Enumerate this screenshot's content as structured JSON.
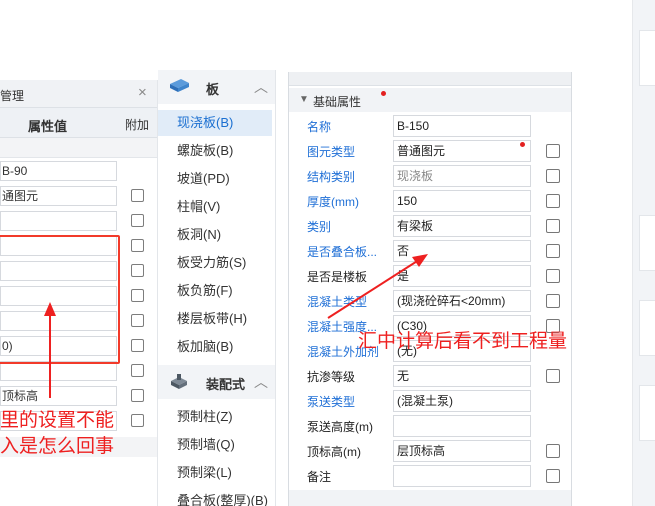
{
  "left_panel": {
    "title": "管理",
    "close_icon": "close-icon",
    "col_value": "属性值",
    "col_attach": "附加",
    "values": [
      "B-90",
      "通图元",
      "",
      "",
      "",
      "",
      "",
      "0)",
      "",
      "顶标高",
      ""
    ]
  },
  "nav": {
    "cat_slab": {
      "label": "板",
      "icon": "slab-icon"
    },
    "slab_items": [
      "现浇板(B)",
      "螺旋板(B)",
      "坡道(PD)",
      "柱帽(V)",
      "板洞(N)",
      "板受力筋(S)",
      "板负筋(F)",
      "楼层板带(H)",
      "板加脑(B)"
    ],
    "active_index": 0,
    "cat_prefab": {
      "label": "装配式",
      "icon": "prefab-icon"
    },
    "prefab_items": [
      "预制柱(Z)",
      "预制墙(Q)",
      "预制梁(L)",
      "叠合板(整厚)(B)"
    ]
  },
  "properties": {
    "group_label": "基础属性",
    "rows": [
      {
        "name": "名称",
        "value": "B-150"
      },
      {
        "name": "图元类型",
        "value": "普通图元"
      },
      {
        "name": "结构类别",
        "value": "现浇板"
      },
      {
        "name": "厚度(mm)",
        "value": "150"
      },
      {
        "name": "类别",
        "value": "有梁板"
      },
      {
        "name": "是否叠合板...",
        "value": "否"
      },
      {
        "name": "是否是楼板",
        "value": "是"
      },
      {
        "name": "混凝土类型",
        "value": "(现浇砼碎石<20mm)"
      },
      {
        "name": "混凝土强度...",
        "value": "(C30)"
      },
      {
        "name": "混凝土外加剂",
        "value": "(无)"
      },
      {
        "name": "抗渗等级",
        "value": "无"
      },
      {
        "name": "泵送类型",
        "value": "(混凝土泵)"
      },
      {
        "name": "泵送高度(m)",
        "value": ""
      },
      {
        "name": "顶标高(m)",
        "value": "层顶标高"
      },
      {
        "name": "备注",
        "value": ""
      }
    ]
  },
  "annotations": {
    "center": "汇中计算后看不到工程量",
    "left_line1": "里的设置不能",
    "left_line2": "入是怎么回事",
    "color": "#ee2020"
  },
  "colors": {
    "accent_blue": "#1f6fd6",
    "nav_active_bg": "#e1ecf8",
    "annotation_red": "#ee2020"
  }
}
